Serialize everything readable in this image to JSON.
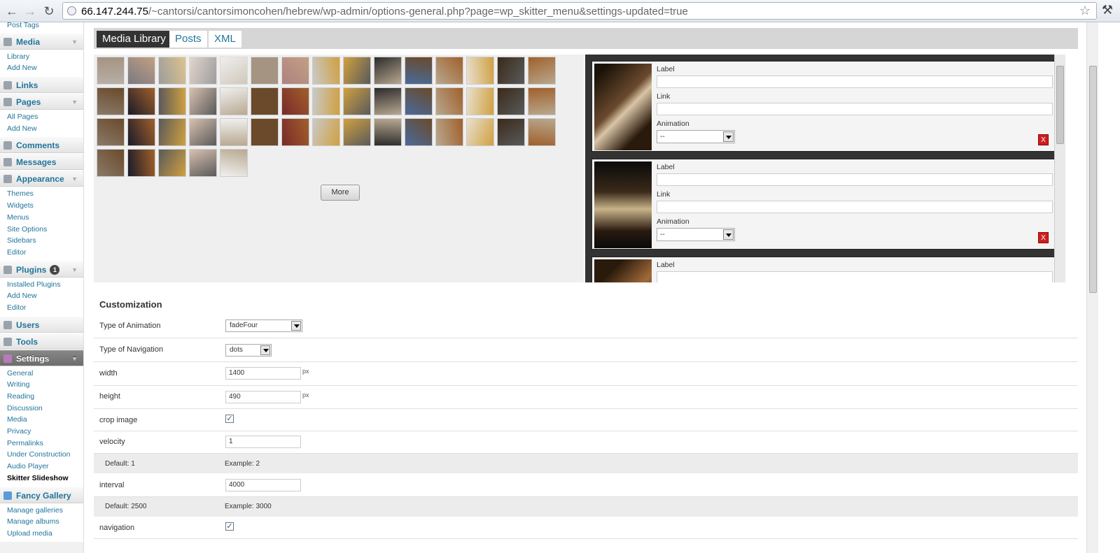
{
  "browser": {
    "url_host": "66.147.244.75",
    "url_path": "/~cantorsi/cantorsimoncohen/hebrew/wp-admin/options-general.php?page=wp_skitter_menu&settings-updated=true"
  },
  "sidebar": {
    "top_items": [
      "Post Tags"
    ],
    "media": {
      "label": "Media",
      "items": [
        "Library",
        "Add New"
      ]
    },
    "links": {
      "label": "Links"
    },
    "pages": {
      "label": "Pages",
      "items": [
        "All Pages",
        "Add New"
      ]
    },
    "comments": {
      "label": "Comments"
    },
    "messages": {
      "label": "Messages"
    },
    "appearance": {
      "label": "Appearance",
      "items": [
        "Themes",
        "Widgets",
        "Menus",
        "Site Options",
        "Sidebars",
        "Editor"
      ]
    },
    "plugins": {
      "label": "Plugins",
      "badge": "1",
      "items": [
        "Installed Plugins",
        "Add New",
        "Editor"
      ]
    },
    "users": {
      "label": "Users"
    },
    "tools": {
      "label": "Tools"
    },
    "settings": {
      "label": "Settings",
      "items": [
        "General",
        "Writing",
        "Reading",
        "Discussion",
        "Media",
        "Privacy",
        "Permalinks",
        "Under Construction",
        "Audio Player",
        "Skitter Slideshow"
      ]
    },
    "fancy_gallery": {
      "label": "Fancy Gallery",
      "items": [
        "Manage galleries",
        "Manage albums",
        "Upload media"
      ]
    }
  },
  "tabs": {
    "media_library": "Media Library",
    "posts": "Posts",
    "xml": "XML"
  },
  "library": {
    "more_label": "More"
  },
  "slide_fields": {
    "label": "Label",
    "link": "Link",
    "animation": "Animation",
    "animation_value": "--",
    "delete": "X"
  },
  "customization": {
    "title": "Customization",
    "animation_type_label": "Type of Animation",
    "animation_type_value": "fadeFour",
    "navigation_type_label": "Type of Navigation",
    "navigation_type_value": "dots",
    "width_label": "width",
    "width_value": "1400",
    "height_label": "height",
    "height_value": "490",
    "px_unit": "px",
    "crop_label": "crop image",
    "velocity_label": "velocity",
    "velocity_value": "1",
    "velocity_default": "Default: 1",
    "velocity_example": "Example: 2",
    "interval_label": "interval",
    "interval_value": "4000",
    "interval_default": "Default: 2500",
    "interval_example": "Example: 3000",
    "navigation_label": "navigation",
    "checkmark": "✓"
  }
}
